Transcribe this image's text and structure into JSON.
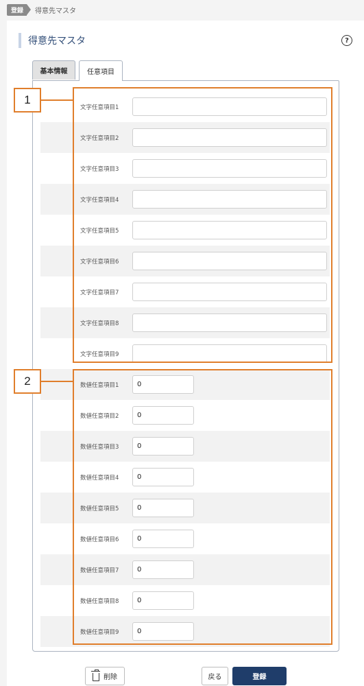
{
  "breadcrumb": {
    "tag": "登録",
    "page": "得意先マスタ"
  },
  "header": {
    "title": "得意先マスタ",
    "help_glyph": "?"
  },
  "tabs": [
    {
      "label": "基本情報",
      "active": false
    },
    {
      "label": "任意項目",
      "active": true
    }
  ],
  "text_fields": [
    {
      "label": "文字任意項目1",
      "value": ""
    },
    {
      "label": "文字任意項目2",
      "value": ""
    },
    {
      "label": "文字任意項目3",
      "value": ""
    },
    {
      "label": "文字任意項目4",
      "value": ""
    },
    {
      "label": "文字任意項目5",
      "value": ""
    },
    {
      "label": "文字任意項目6",
      "value": ""
    },
    {
      "label": "文字任意項目7",
      "value": ""
    },
    {
      "label": "文字任意項目8",
      "value": ""
    },
    {
      "label": "文字任意項目9",
      "value": ""
    }
  ],
  "number_fields": [
    {
      "label": "数値任意項目1",
      "value": "0"
    },
    {
      "label": "数値任意項目2",
      "value": "0"
    },
    {
      "label": "数値任意項目3",
      "value": "0"
    },
    {
      "label": "数値任意項目4",
      "value": "0"
    },
    {
      "label": "数値任意項目5",
      "value": "0"
    },
    {
      "label": "数値任意項目6",
      "value": "0"
    },
    {
      "label": "数値任意項目7",
      "value": "0"
    },
    {
      "label": "数値任意項目8",
      "value": "0"
    },
    {
      "label": "数値任意項目9",
      "value": "0"
    }
  ],
  "callouts": [
    {
      "number": "1"
    },
    {
      "number": "2"
    }
  ],
  "footer": {
    "delete_label": "削除",
    "back_label": "戻る",
    "register_label": "登録"
  },
  "colors": {
    "accent_orange": "#e07e2b",
    "primary_navy": "#1f3d6a",
    "title_blue": "#334f79"
  },
  "icons": {
    "help": "help-circle-icon",
    "delete": "trash-icon"
  }
}
